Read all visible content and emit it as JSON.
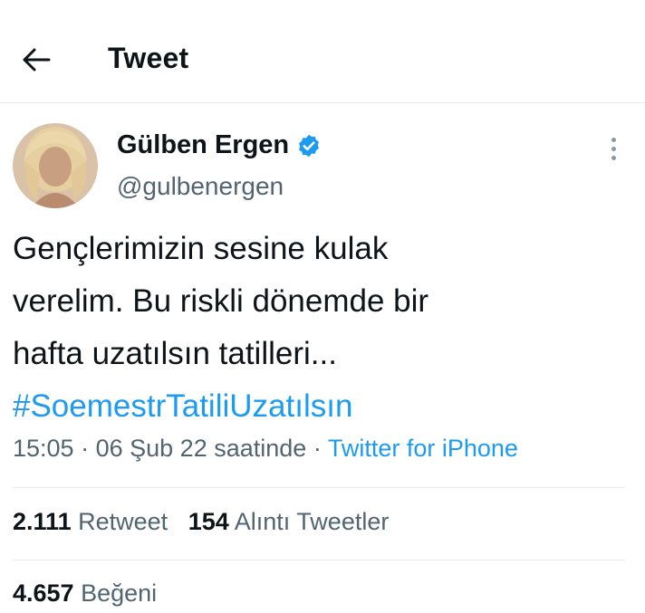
{
  "header": {
    "title": "Tweet"
  },
  "tweet": {
    "author_name": "Gülben Ergen",
    "author_handle": "@gulbenergen",
    "text_lines": [
      "Gençlerimizin sesine kulak",
      "verelim. Bu riskli dönemde bir",
      "hafta uzatılsın tatilleri..."
    ],
    "hashtag": "#SoemestrTatiliUzatılsın",
    "time": "15:05",
    "date": "06 Şub 22 saatinde",
    "separator": "·",
    "source": "Twitter for iPhone"
  },
  "stats": {
    "retweets_count": "2.111",
    "retweets_label": "Retweet",
    "quotes_count": "154",
    "quotes_label": "Alıntı Tweetler",
    "likes_count": "4.657",
    "likes_label": "Beğeni"
  },
  "colors": {
    "accent": "#1d9bf0",
    "text": "#0f1419",
    "secondary": "#536471",
    "divider": "#e6e9ec"
  },
  "icons": {
    "back": "arrow-left-icon",
    "verified": "verified-badge-icon",
    "more": "more-vertical-icon"
  }
}
